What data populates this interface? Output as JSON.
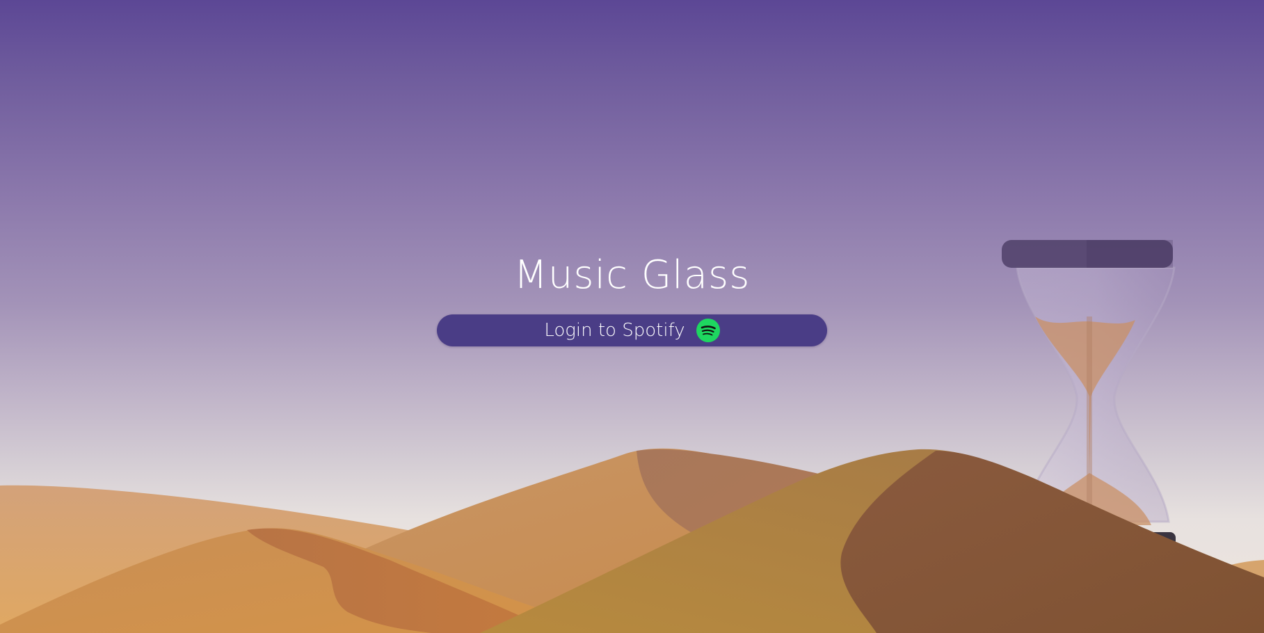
{
  "app": {
    "title": "Music Glass"
  },
  "login": {
    "label": "Login to Spotify",
    "icon": "spotify-icon"
  },
  "colors": {
    "button_bg": "#4a3d86",
    "spotify_green": "#1ed760",
    "sky_top": "#5c4795",
    "sand_light": "#d9a56a",
    "sand_dark": "#8a5a3a"
  }
}
